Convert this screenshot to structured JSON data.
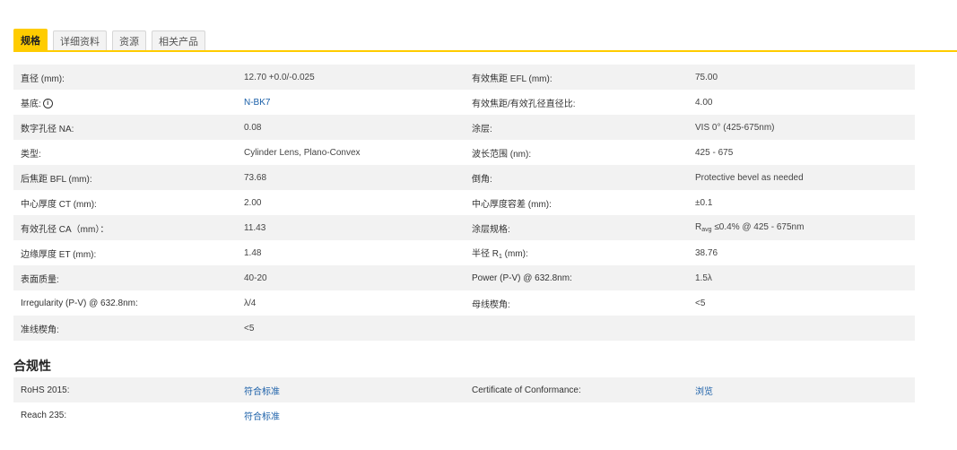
{
  "tabs": [
    {
      "label": "规格",
      "active": true
    },
    {
      "label": "详细资料",
      "active": false
    },
    {
      "label": "资源",
      "active": false
    },
    {
      "label": "相关产品",
      "active": false
    }
  ],
  "specs": [
    {
      "l1": "直径 (mm):",
      "v1": "12.70 +0.0/-0.025",
      "l2": "有效焦距 EFL (mm):",
      "v2": "75.00"
    },
    {
      "l1": "基底:",
      "v1": "N-BK7",
      "l2": "有效焦距/有效孔径直径比:",
      "v2": "4.00"
    },
    {
      "l1": "数字孔径 NA:",
      "v1": "0.08",
      "l2": "涂层:",
      "v2": "VIS 0° (425-675nm)"
    },
    {
      "l1": "类型:",
      "v1": "Cylinder Lens, Plano-Convex",
      "l2": "波长范围 (nm):",
      "v2": "425 - 675"
    },
    {
      "l1": "后焦距 BFL (mm):",
      "v1": "73.68",
      "l2": "倒角:",
      "v2": "Protective bevel as needed"
    },
    {
      "l1": "中心厚度 CT (mm):",
      "v1": "2.00",
      "l2": "中心厚度容差 (mm):",
      "v2": "±0.1"
    },
    {
      "l1": "有效孔径 CA（mm）：",
      "v1": "11.43",
      "l2": "涂层规格:",
      "v2_prefix": "R",
      "v2_sub": "avg",
      "v2": "≤0.4% @ 425 - 675nm"
    },
    {
      "l1": "边缘厚度 ET (mm):",
      "v1": "1.48",
      "l2": "半径 R",
      "l2_sub": "1",
      "l2_suffix": " (mm):",
      "v2": "38.76"
    },
    {
      "l1": "表面质量:",
      "v1": "40-20",
      "l2": "Power (P-V) @ 632.8nm:",
      "v2": "1.5λ"
    },
    {
      "l1": "Irregularity (P-V) @ 632.8nm:",
      "v1": "λ/4",
      "l2": "母线楔角:",
      "v2": "<5"
    },
    {
      "l1": "准线楔角:",
      "v1": "<5",
      "l2": "",
      "v2": ""
    }
  ],
  "compliance": {
    "title": "合规性",
    "rows": [
      {
        "l1": "RoHS 2015:",
        "v1": "符合标准",
        "l2": "Certificate of Conformance:",
        "v2": "浏览"
      },
      {
        "l1": "Reach 235:",
        "v1": "符合标准",
        "l2": "",
        "v2": ""
      }
    ]
  }
}
